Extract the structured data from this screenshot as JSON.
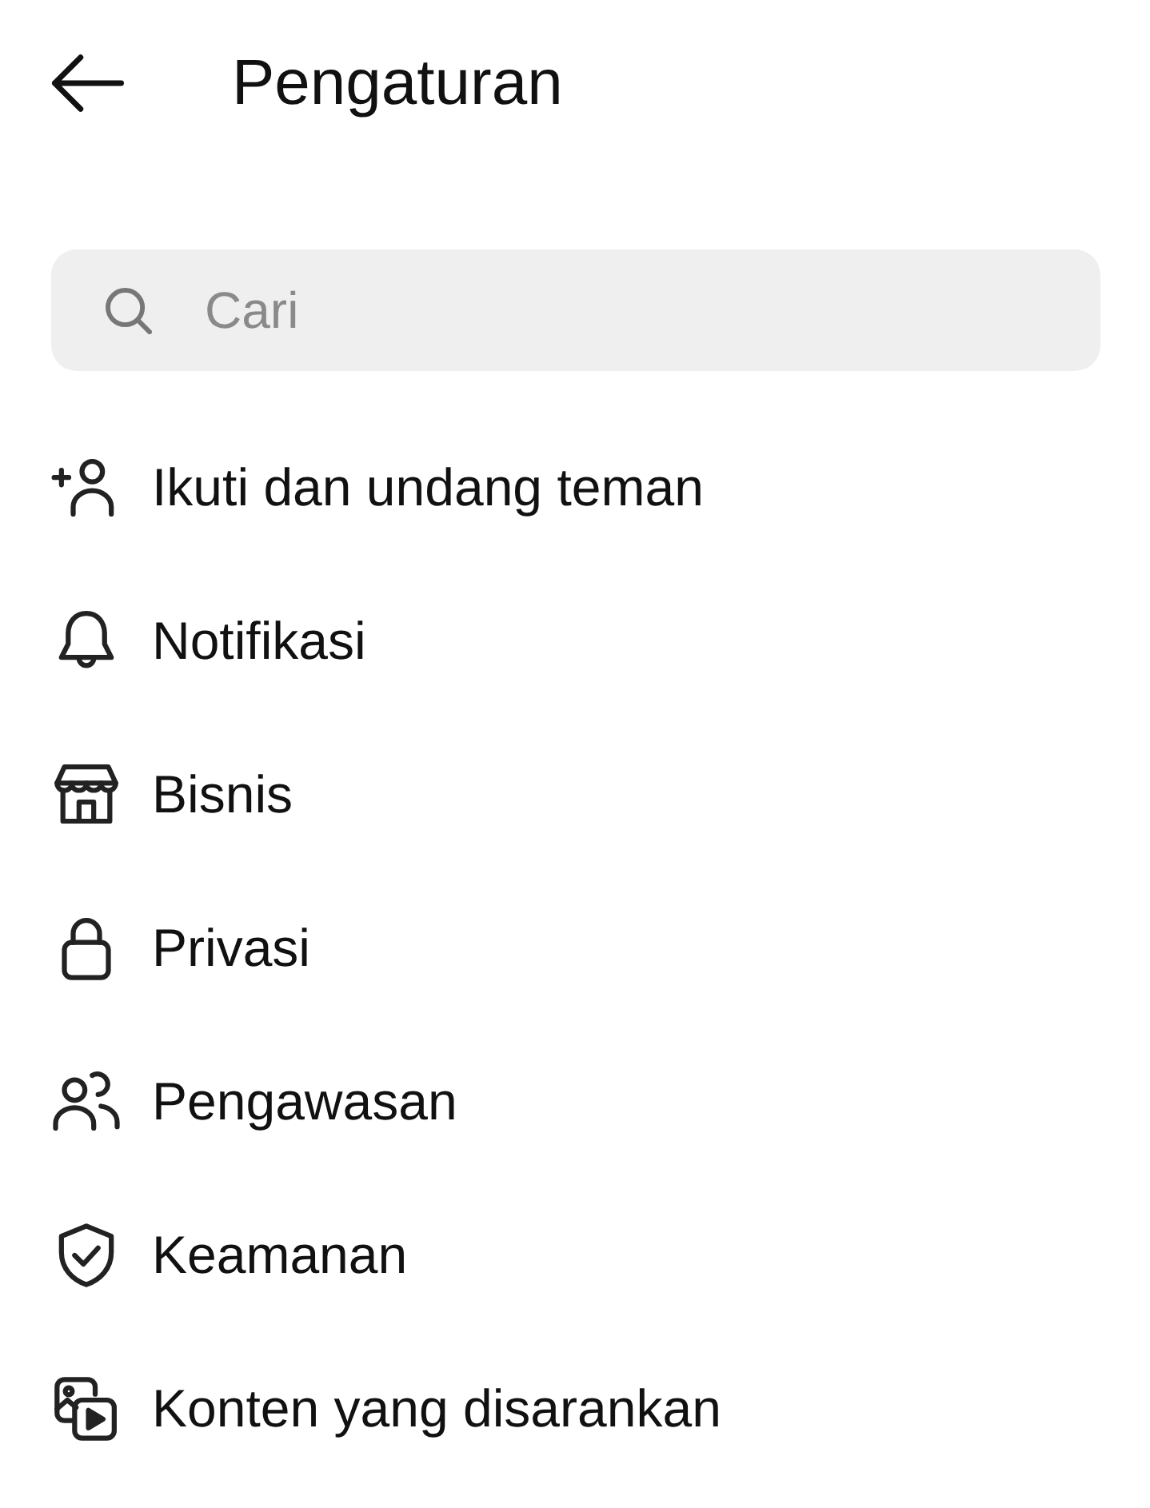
{
  "header": {
    "title": "Pengaturan"
  },
  "search": {
    "placeholder": "Cari"
  },
  "menu_items": [
    {
      "label": "Ikuti dan undang teman"
    },
    {
      "label": "Notifikasi"
    },
    {
      "label": "Bisnis"
    },
    {
      "label": "Privasi"
    },
    {
      "label": "Pengawasan"
    },
    {
      "label": "Keamanan"
    },
    {
      "label": "Konten yang disarankan"
    }
  ]
}
